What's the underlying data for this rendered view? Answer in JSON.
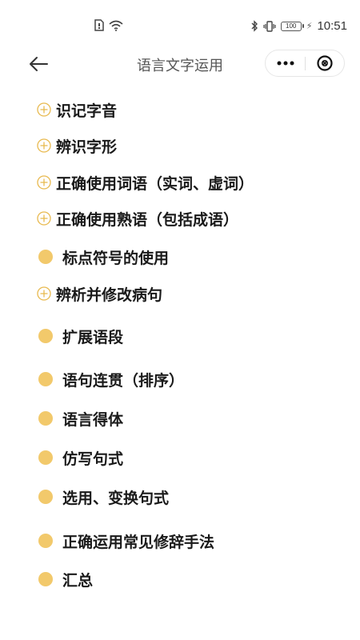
{
  "status_bar": {
    "time": "10:51",
    "battery": "100"
  },
  "nav": {
    "title": "语言文字运用"
  },
  "colors": {
    "accent": "#f2c96b",
    "plus_icon": "#e8b94e"
  },
  "items": [
    {
      "label": "识记字音",
      "icon": "plus-circle-icon"
    },
    {
      "label": "辨识字形",
      "icon": "plus-circle-icon"
    },
    {
      "label": "正确使用词语（实词、虚词）",
      "icon": "plus-circle-icon"
    },
    {
      "label": "正确使用熟语（包括成语）",
      "icon": "plus-circle-icon"
    },
    {
      "label": "标点符号的使用",
      "icon": "dot-icon"
    },
    {
      "label": "辨析并修改病句",
      "icon": "plus-circle-icon"
    },
    {
      "label": "扩展语段",
      "icon": "dot-icon"
    },
    {
      "label": "语句连贯（排序）",
      "icon": "dot-icon"
    },
    {
      "label": "语言得体",
      "icon": "dot-icon"
    },
    {
      "label": "仿写句式",
      "icon": "dot-icon"
    },
    {
      "label": "选用、变换句式",
      "icon": "dot-icon"
    },
    {
      "label": "正确运用常见修辞手法",
      "icon": "dot-icon"
    },
    {
      "label": "汇总",
      "icon": "dot-icon"
    }
  ]
}
